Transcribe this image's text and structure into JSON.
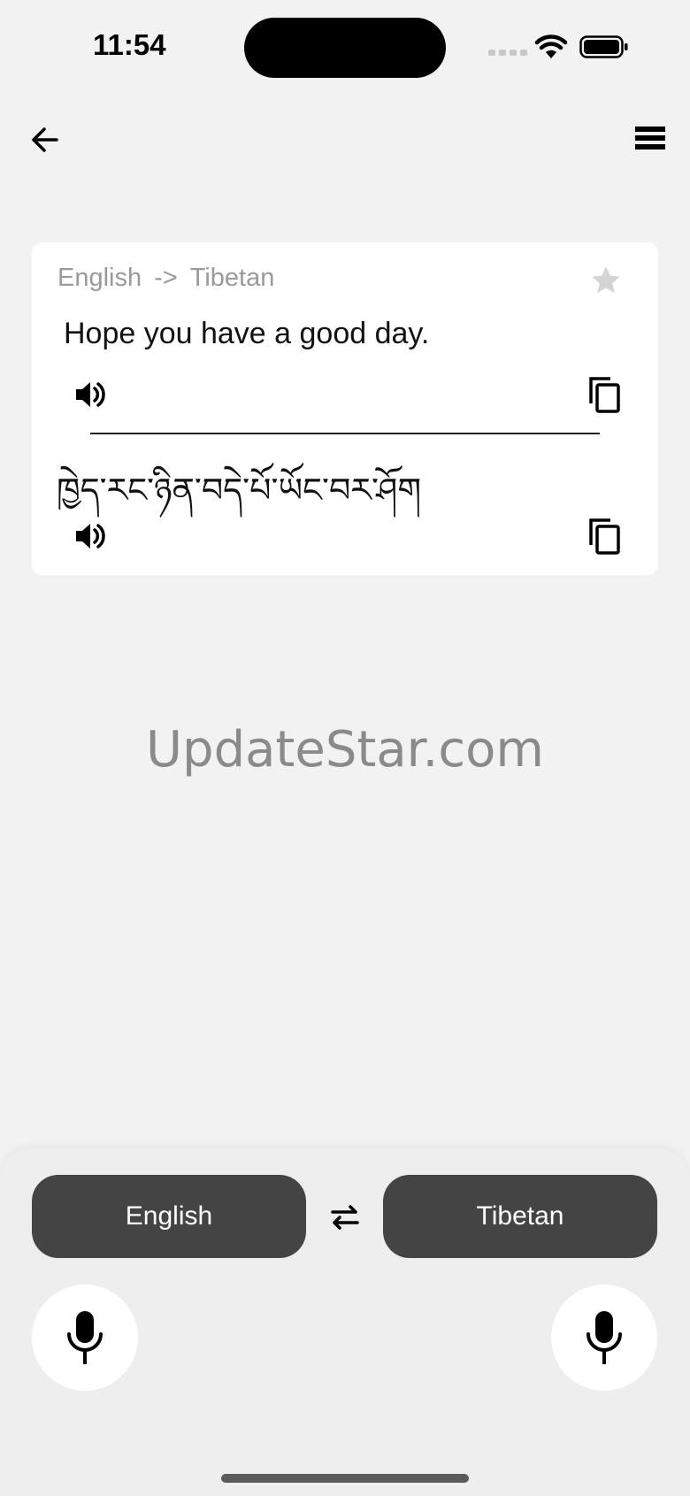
{
  "status_bar": {
    "time": "11:54"
  },
  "header": {
    "back_icon": "arrow-left-icon",
    "menu_icon": "stack-menu-icon"
  },
  "translation_card": {
    "source_language": "English",
    "arrow": "->",
    "target_language": "Tibetan",
    "favorite_icon": "star-icon",
    "source_text": "Hope you have a good day.",
    "target_text": "ཁྱེད་རང་ཉིན་བདེ་པོ་ཡོང་བར་ཤོག",
    "speaker_icon": "speaker-icon",
    "copy_icon": "copy-icon",
    "star_color": "#d4d4d4"
  },
  "watermark": "UpdateStar.com",
  "bottom_panel": {
    "left_language": "English",
    "right_language": "Tibetan",
    "swap_icon": "swap-arrows-icon",
    "mic_icon": "microphone-icon",
    "button_color": "#444444"
  }
}
